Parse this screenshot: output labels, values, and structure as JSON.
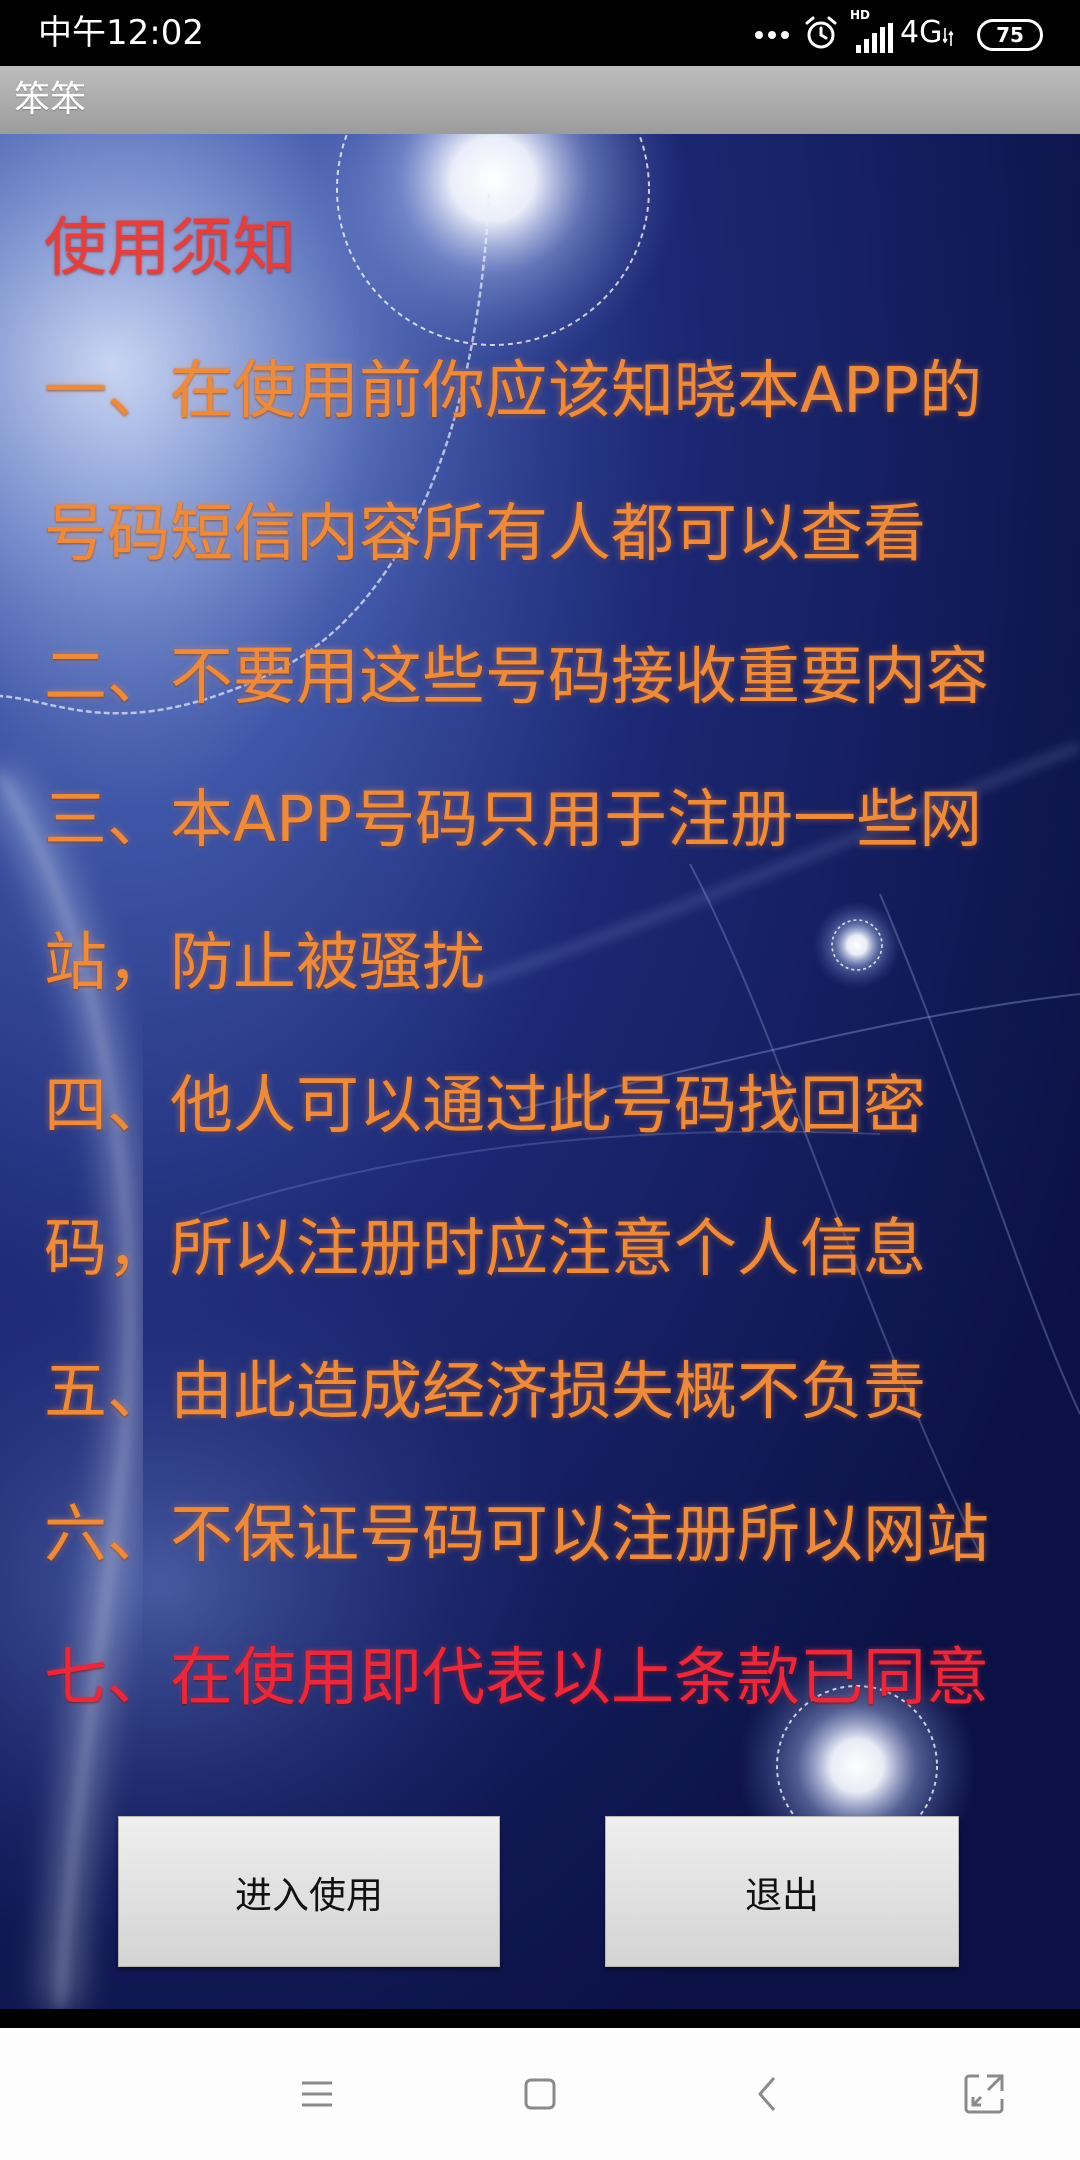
{
  "status_bar": {
    "time": "中午12:02",
    "hd_label": "HD",
    "network_label": "4G",
    "battery_level": "75",
    "icons": [
      "more-notifications-icon",
      "alarm-icon",
      "signal-icon",
      "data-arrows-icon",
      "battery-icon"
    ]
  },
  "app_bar": {
    "title": "笨笨"
  },
  "notice": {
    "title": "使用须知",
    "lines": [
      "一、在使用前你应该知晓本APP的",
      "号码短信内容所有人都可以查看",
      "二、不要用这些号码接收重要内容",
      "三、本APP号码只用于注册一些网",
      "站，防止被骚扰",
      "四、他人可以通过此号码找回密",
      "码，所以注册时应注意个人信息",
      "五、由此造成经济损失概不负责",
      "六、不保证号码可以注册所以网站",
      "七、在使用即代表以上条款已同意"
    ],
    "colors": {
      "title": "#e2403e",
      "body": "#ec8a3e",
      "highlight": "#e8283c"
    }
  },
  "actions": {
    "enter_label": "进入使用",
    "exit_label": "退出"
  },
  "nav_bar": {
    "icons": [
      "menu-icon",
      "home-icon",
      "back-icon",
      "screenshot-icon"
    ]
  },
  "colors": {
    "status_bar": "#000000",
    "app_bar": "#a8a8a8",
    "background": "#141c60",
    "button": "#e0e0e0",
    "nav_bar": "#fdfdfd",
    "nav_icon": "#8a8a8a"
  }
}
